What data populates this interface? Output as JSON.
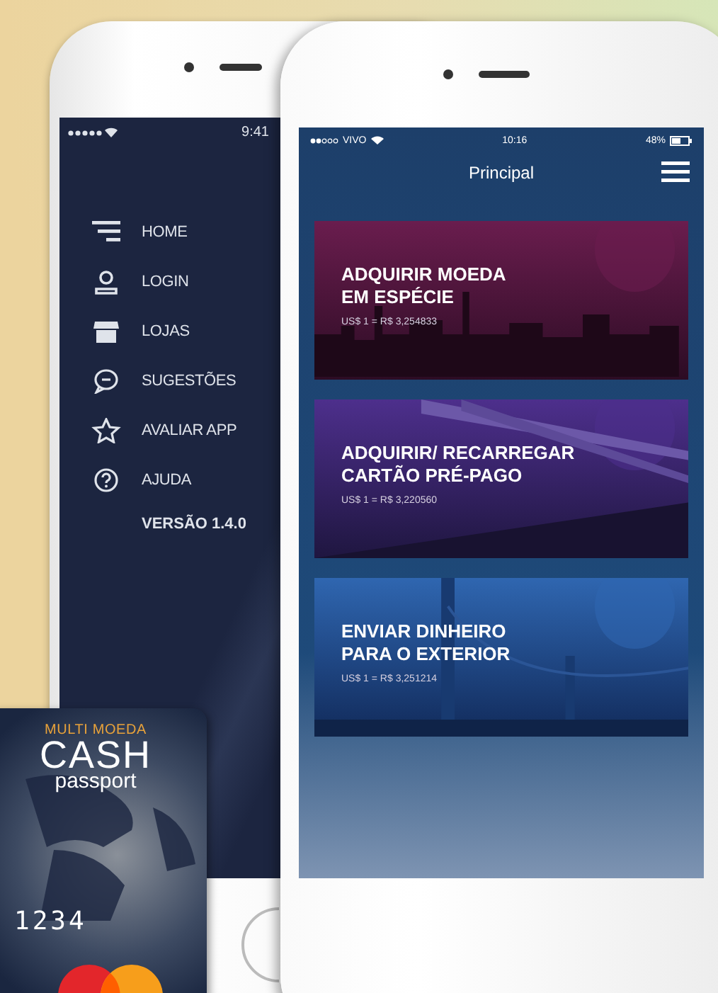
{
  "back_phone": {
    "status_bar": {
      "time": "9:41"
    },
    "menu": [
      {
        "label": "HOME",
        "kind": "home"
      },
      {
        "label": "LOGIN",
        "kind": "user"
      },
      {
        "label": "LOJAS",
        "kind": "store"
      },
      {
        "label": "SUGESTÕES",
        "kind": "chat"
      },
      {
        "label": "AVALIAR APP",
        "kind": "star"
      },
      {
        "label": "AJUDA",
        "kind": "help"
      }
    ],
    "version": "VERSÃO 1.4.0"
  },
  "front_phone": {
    "status_bar": {
      "carrier": "VIVO",
      "time": "10:16",
      "battery": "48%"
    },
    "title": "Principal",
    "options": [
      {
        "title": "ADQUIRIR MOEDA\nEM ESPÉCIE",
        "rate": "US$ 1 = R$ 3,254833",
        "kind": "city"
      },
      {
        "title": "ADQUIRIR/ RECARREGAR\nCARTÃO PRÉ-PAGO",
        "rate": "US$ 1 = R$ 3,220560",
        "kind": "bridge"
      },
      {
        "title": "ENVIAR DINHEIRO\nPARA O EXTERIOR",
        "rate": "US$ 1 = R$ 3,251214",
        "kind": "towers"
      }
    ]
  },
  "card": {
    "tagline": "MULTI MOEDA",
    "brand": "CASH",
    "brand_sub": "passport",
    "number": "1234"
  }
}
